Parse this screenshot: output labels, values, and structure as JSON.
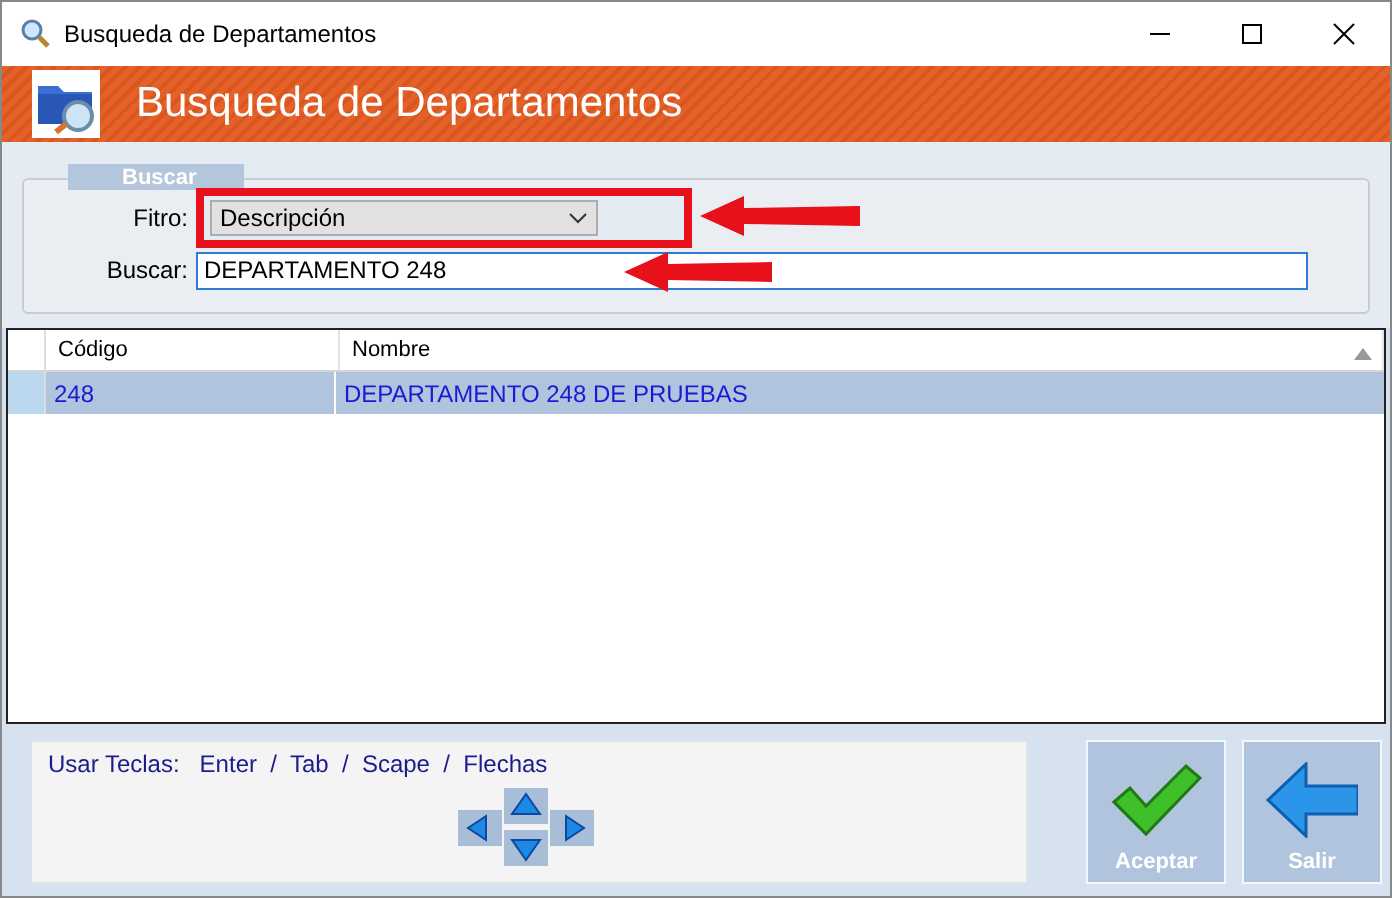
{
  "window": {
    "title": "Busqueda de Departamentos"
  },
  "header": {
    "title": "Busqueda de Departamentos"
  },
  "search_group": {
    "label": "Buscar",
    "filter_label": "Fitro:",
    "filter_value": "Descripción",
    "search_label": "Buscar:",
    "search_value": "DEPARTAMENTO 248"
  },
  "table": {
    "columns": [
      "Código",
      "Nombre"
    ],
    "rows": [
      {
        "cells": [
          "248",
          "DEPARTAMENTO 248 DE PRUEBAS"
        ],
        "selected": true
      }
    ]
  },
  "hint": "Usar Teclas:   Enter  /  Tab  /  Scape  /  Flechas",
  "buttons": [
    {
      "kind": "accept",
      "label": "Aceptar"
    },
    {
      "kind": "exit",
      "label": "Salir"
    }
  ]
}
